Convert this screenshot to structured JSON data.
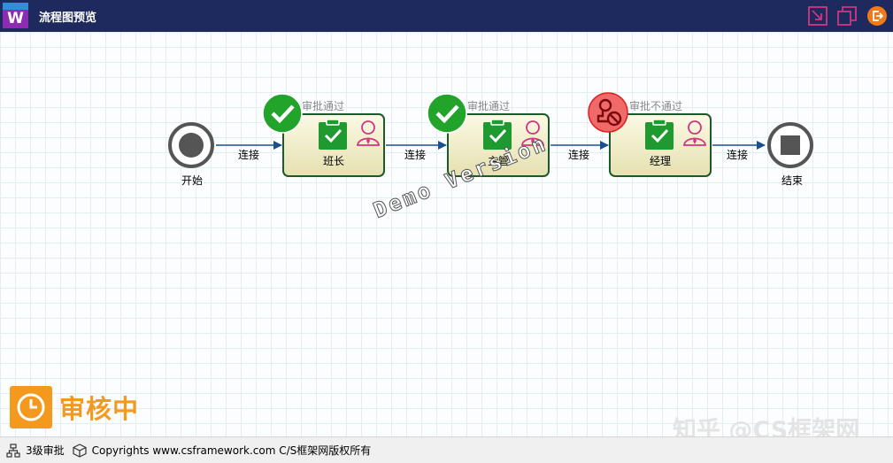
{
  "window": {
    "title": "流程图预览",
    "app_letter": "W"
  },
  "colors": {
    "titlebar": "#1e2a5e",
    "approved": "#22a32a",
    "rejected": "#e84b4b",
    "pending": "#f39a1e",
    "node_border": "#1b5a2a",
    "edge": "#1d4f8f"
  },
  "titlebar_buttons": [
    {
      "name": "shrink-window-icon"
    },
    {
      "name": "restore-window-icon"
    },
    {
      "name": "exit-icon"
    }
  ],
  "flow": {
    "start": {
      "label": "开始"
    },
    "end": {
      "label": "结束"
    },
    "edges": [
      "连接",
      "连接",
      "连接",
      "连接"
    ],
    "nodes": [
      {
        "label": "班长",
        "status": "审批通过",
        "status_type": "approved"
      },
      {
        "label": "主管",
        "status": "审批通过",
        "status_type": "approved"
      },
      {
        "label": "经理",
        "status": "审批不通过",
        "status_type": "rejected"
      }
    ]
  },
  "watermark": "Demo Version",
  "state": {
    "label": "审核中",
    "icon": "clock-icon"
  },
  "overlay_mark": "知乎 @CS框架网",
  "statusbar": {
    "level": "3级审批",
    "copyright": "Copyrights www.csframework.com C/S框架网版权所有"
  }
}
